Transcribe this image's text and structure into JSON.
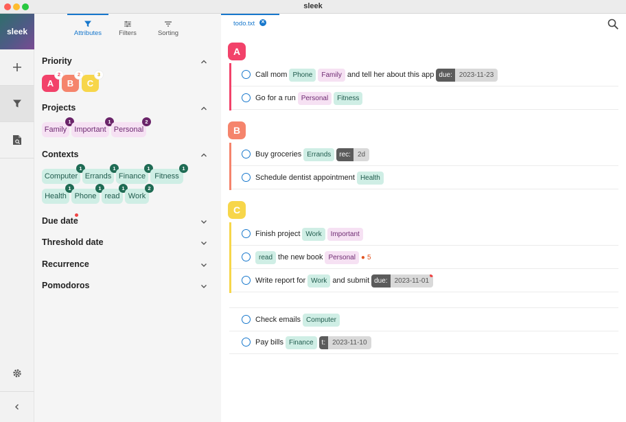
{
  "window": {
    "title": "sleek"
  },
  "rail": {
    "logo": "sleek"
  },
  "sidebar": {
    "tabs": [
      {
        "label": "Attributes",
        "icon": "filter-icon"
      },
      {
        "label": "Filters",
        "icon": "sliders-icon"
      },
      {
        "label": "Sorting",
        "icon": "sort-icon"
      }
    ],
    "priority": {
      "title": "Priority",
      "chips": [
        {
          "label": "A",
          "count": "2",
          "color": "#f2426a"
        },
        {
          "label": "B",
          "count": "2",
          "color": "#f5846c"
        },
        {
          "label": "C",
          "count": "3",
          "color": "#f7d64a"
        }
      ]
    },
    "projects": {
      "title": "Projects",
      "chips": [
        {
          "label": "Family",
          "count": "1"
        },
        {
          "label": "Important",
          "count": "1"
        },
        {
          "label": "Personal",
          "count": "2"
        }
      ]
    },
    "contexts": {
      "title": "Contexts",
      "chips": [
        {
          "label": "Computer",
          "count": "1"
        },
        {
          "label": "Errands",
          "count": "1"
        },
        {
          "label": "Finance",
          "count": "1"
        },
        {
          "label": "Fitness",
          "count": "1"
        },
        {
          "label": "Health",
          "count": "1"
        },
        {
          "label": "Phone",
          "count": "1"
        },
        {
          "label": "read",
          "count": "1"
        },
        {
          "label": "Work",
          "count": "2"
        }
      ]
    },
    "collapsed": [
      {
        "title": "Due date"
      },
      {
        "title": "Threshold date"
      },
      {
        "title": "Recurrence"
      },
      {
        "title": "Pomodoros"
      }
    ]
  },
  "main": {
    "file_tab": {
      "label": "todo.txt"
    },
    "groups": [
      {
        "label": "A",
        "color": "#f2426a"
      },
      {
        "label": "B",
        "color": "#f5846c"
      },
      {
        "label": "C",
        "color": "#f7d64a"
      }
    ],
    "todos": {
      "a1": {
        "t1": "Call mom",
        "ctx": "Phone",
        "proj": "Family",
        "t2": "and tell her about this app",
        "key": "due:",
        "val": "2023-11-23"
      },
      "a2": {
        "t1": "Go for a run",
        "proj": "Personal",
        "ctx": "Fitness"
      },
      "b1": {
        "t1": "Buy groceries",
        "ctx": "Errands",
        "key": "rec:",
        "val": "2d"
      },
      "b2": {
        "t1": "Schedule dentist appointment",
        "ctx": "Health"
      },
      "c1": {
        "t1": "Finish project",
        "ctx": "Work",
        "proj": "Important"
      },
      "c2": {
        "ctx": "read",
        "t1": "the new book",
        "proj": "Personal",
        "pomodoros": "5"
      },
      "c3": {
        "t1": "Write report for",
        "ctx": "Work",
        "t2": "and submit",
        "key": "due:",
        "val": "2023-11-01"
      },
      "n1": {
        "t1": "Check emails",
        "ctx": "Computer"
      },
      "n2": {
        "t1": "Pay bills",
        "ctx": "Finance",
        "key": "t:",
        "val": "2023-11-10"
      }
    }
  }
}
